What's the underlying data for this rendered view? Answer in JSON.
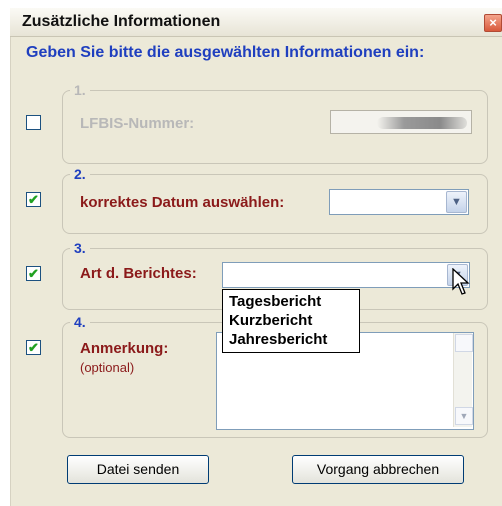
{
  "window": {
    "title": "Zusätzliche Informationen",
    "close_glyph": "×"
  },
  "prompt": "Geben Sie bitte die ausgewählten Informationen ein:",
  "groups": [
    {
      "number": "1.",
      "label": "LFBIS-Nummer:",
      "checked": false,
      "enabled": false
    },
    {
      "number": "2.",
      "label": "korrektes Datum auswählen:",
      "checked": true,
      "enabled": true
    },
    {
      "number": "3.",
      "label": "Art d. Berichtes:",
      "checked": true,
      "enabled": true
    },
    {
      "number": "4.",
      "label": "Anmerkung:",
      "sublabel": "(optional)",
      "checked": true,
      "enabled": true
    }
  ],
  "check_glyph": "✔",
  "dropdown_arrow": "▼",
  "report_options": [
    "Tagesbericht",
    "Kurzbericht",
    "Jahresbericht"
  ],
  "buttons": {
    "send": "Datei senden",
    "cancel": "Vorgang abbrechen"
  },
  "colors": {
    "prompt": "#1f3fbf",
    "label_enabled": "#8b1a1a",
    "label_disabled": "#b8b8b8",
    "number_enabled": "#1f3fbf",
    "number_disabled": "#b8b8b8"
  }
}
